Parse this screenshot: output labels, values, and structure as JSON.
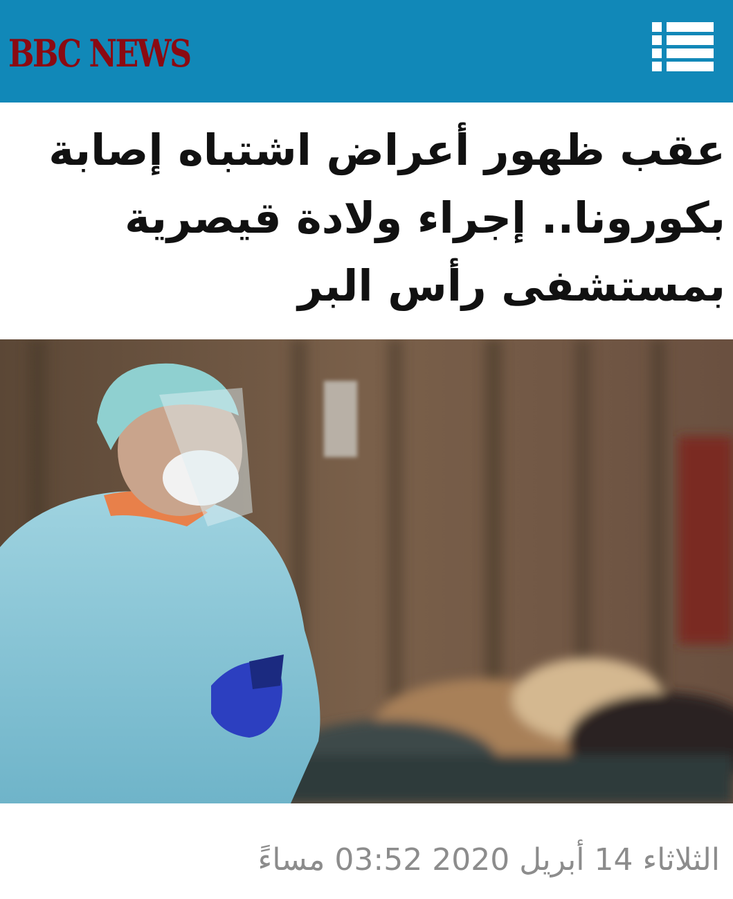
{
  "header": {
    "logo": "BBC NEWS",
    "menu_icon": "menu-icon",
    "background_color": "#1188b8",
    "logo_color": "#8b0a12"
  },
  "article": {
    "headline_lines": [
      "عقب ظهور أعراض اشتباه إصابة",
      "بكورونا.. إجراء ولادة قيصرية",
      "بمستشفى رأس البر"
    ],
    "timestamp": "الثلاثاء 14 أبريل 2020 03:52 مساءً"
  }
}
